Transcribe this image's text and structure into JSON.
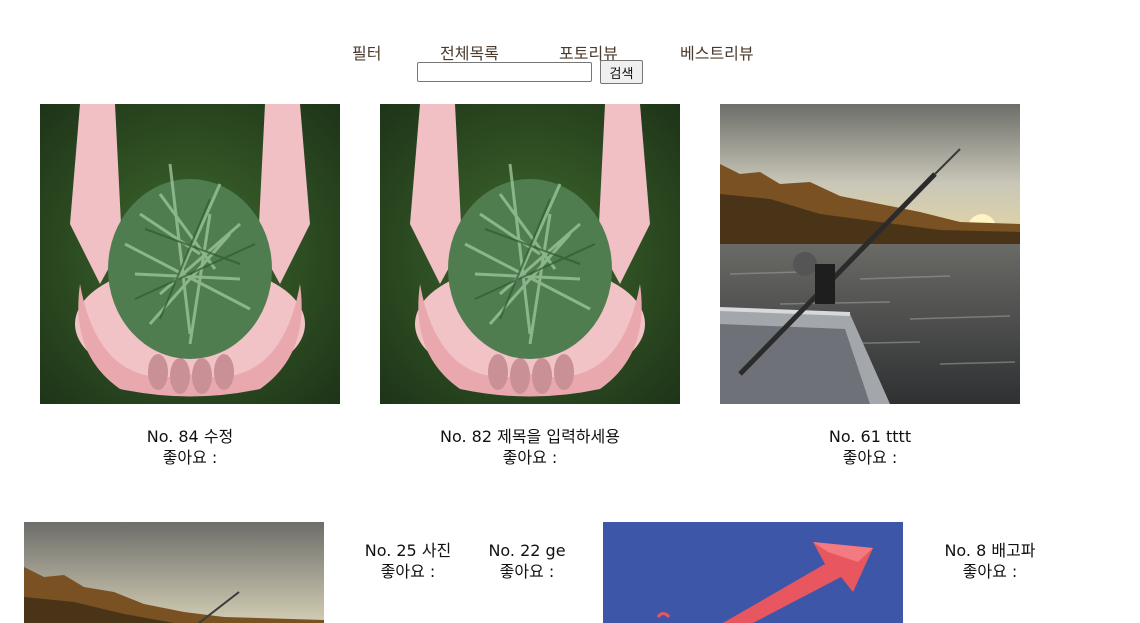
{
  "nav": {
    "filter": "필터",
    "all": "전체목록",
    "photo_review": "포토리뷰",
    "best_review": "베스트리뷰"
  },
  "search": {
    "value": "",
    "button_label": "검색"
  },
  "posts": [
    {
      "title": "No. 84 수정",
      "likes": "좋아요 :",
      "image": "hands-pine-needles"
    },
    {
      "title": "No. 82 제목을 입력하세용",
      "likes": "좋아요 :",
      "image": "hands-pine-needles"
    },
    {
      "title": "No. 61 tttt",
      "likes": "좋아요 :",
      "image": "fishing-boat-lake"
    },
    {
      "title": "No. 25 사진",
      "likes": "좋아요 :",
      "image": "fishing-boat-lake"
    },
    {
      "title": "No. 22 ge",
      "likes": "좋아요 :",
      "image": ""
    },
    {
      "title": "No. 8 배고파",
      "likes": "좋아요 :",
      "image": "red-arrow-blue"
    }
  ]
}
